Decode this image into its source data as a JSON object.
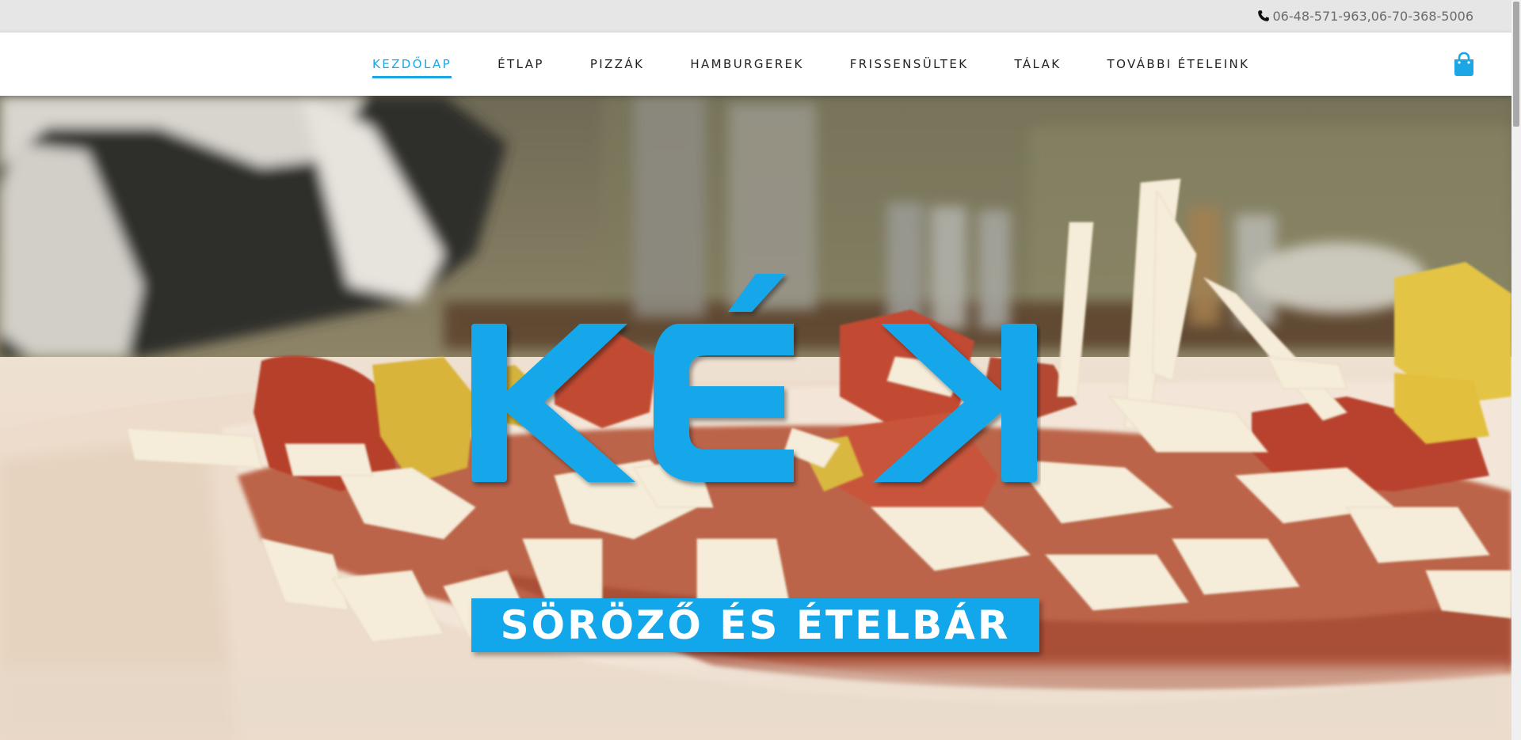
{
  "topbar": {
    "phone_icon": "phone-icon",
    "phone_text": "06-48-571-963,06-70-368-5006"
  },
  "nav": {
    "items": [
      {
        "label": "KEZDŐLAP",
        "active": true
      },
      {
        "label": "ÉTLAP",
        "active": false
      },
      {
        "label": "PIZZÁK",
        "active": false
      },
      {
        "label": "HAMBURGEREK",
        "active": false
      },
      {
        "label": "FRISSENSÜLTEK",
        "active": false
      },
      {
        "label": "TÁLAK",
        "active": false
      },
      {
        "label": "TOVÁBBI ÉTELEINK",
        "active": false
      }
    ],
    "cart_icon": "shopping-bag-icon"
  },
  "hero": {
    "logo_text": "KÉK",
    "tagline": "SÖRÖZŐ ÉS ÉTELBÁR"
  },
  "colors": {
    "accent": "#1ba7e6",
    "logo_blue": "#12a7ea",
    "topbar_bg": "#e6e6e6",
    "phone_text": "#6b6b6b"
  }
}
